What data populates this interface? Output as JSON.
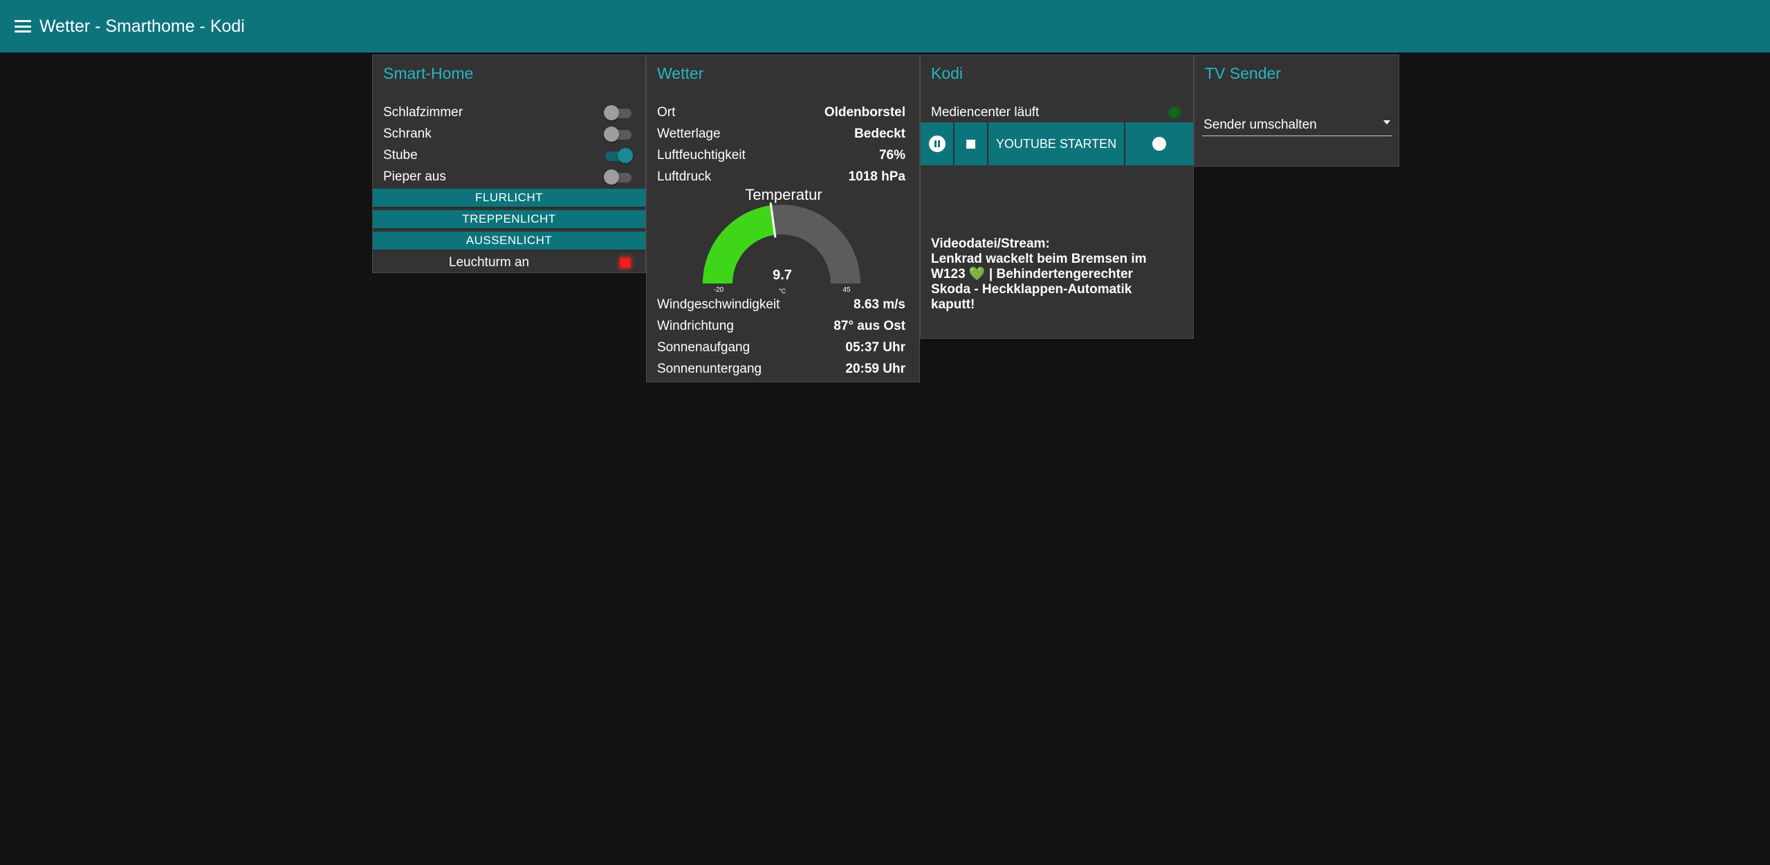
{
  "app": {
    "title": "Wetter - Smarthome - Kodi"
  },
  "smarthome": {
    "title": "Smart-Home",
    "switches": [
      {
        "label": "Schlafzimmer",
        "on": false
      },
      {
        "label": "Schrank",
        "on": false
      },
      {
        "label": "Stube",
        "on": true
      },
      {
        "label": "Pieper aus",
        "on": false
      }
    ],
    "buttons": [
      "FLURLICHT",
      "TREPPENLICHT",
      "AUSSENLICHT"
    ],
    "leuchtturm": {
      "label": "Leuchturm an",
      "led_color": "#ff1a1a"
    }
  },
  "wetter": {
    "title": "Wetter",
    "rows_top": [
      {
        "label": "Ort",
        "value": "Oldenborstel"
      },
      {
        "label": "Wetterlage",
        "value": "Bedeckt"
      },
      {
        "label": "Luftfeuchtigkeit",
        "value": "76%"
      },
      {
        "label": "Luftdruck",
        "value": "1018 hPa"
      }
    ],
    "gauge": {
      "title": "Temperatur",
      "value": 9.7,
      "value_text": "9.7",
      "min": -20,
      "max": 45,
      "min_text": "-20",
      "max_text": "45",
      "unit": "°C",
      "fill_color": "#3fd61a",
      "track_color": "#5c5c5c"
    },
    "rows_bottom": [
      {
        "label": "Windgeschwindigkeit",
        "value": "8.63 m/s"
      },
      {
        "label": "Windrichtung",
        "value": "87° aus Ost"
      },
      {
        "label": "Sonnenaufgang",
        "value": "05:37 Uhr"
      },
      {
        "label": "Sonnenuntergang",
        "value": "20:59 Uhr"
      }
    ]
  },
  "kodi": {
    "title": "Kodi",
    "status_label": "Mediencenter läuft",
    "youtube_label": "YOUTUBE STARTEN",
    "video_heading": "Videodatei/Stream:",
    "video_title_a": "Lenkrad wackelt beim Bremsen im W123",
    "video_title_b": "| Behindertengerechter Skoda - Heckklappen-Automatik kaputt!"
  },
  "tv": {
    "title": "TV Sender",
    "select_label": "Sender umschalten"
  }
}
